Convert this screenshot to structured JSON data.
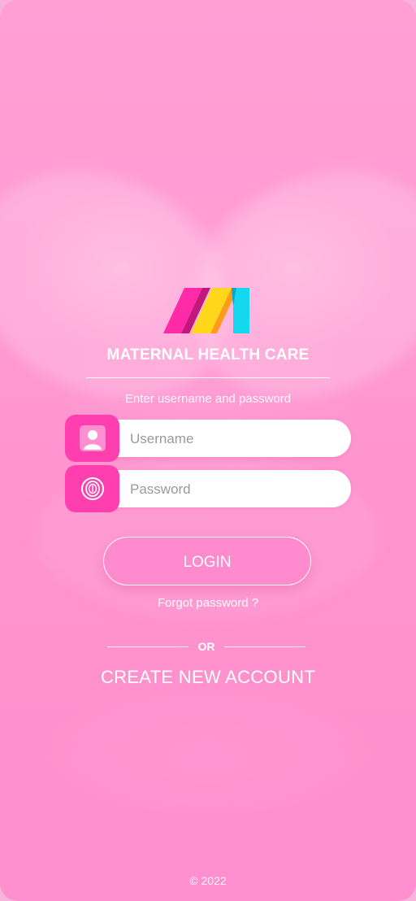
{
  "app": {
    "title": "MATERNAL HEALTH CARE"
  },
  "login_form": {
    "hint": "Enter username and password",
    "username": {
      "value": "",
      "placeholder": "Username",
      "icon": "user-icon"
    },
    "password": {
      "value": "",
      "placeholder": "Password",
      "icon": "fingerprint-icon"
    },
    "login_label": "LOGIN",
    "forgot_label": "Forgot password ?"
  },
  "divider": {
    "or_label": "OR"
  },
  "signup": {
    "create_label": "CREATE NEW ACCOUNT"
  },
  "footer": {
    "copyright": "© 2022"
  },
  "colors": {
    "background": "#ff9bd2",
    "icon_box": "#ff3fb0",
    "logo_pink": "#ff2aa8",
    "logo_yellow": "#ffd71a",
    "logo_cyan": "#14d8f0"
  }
}
